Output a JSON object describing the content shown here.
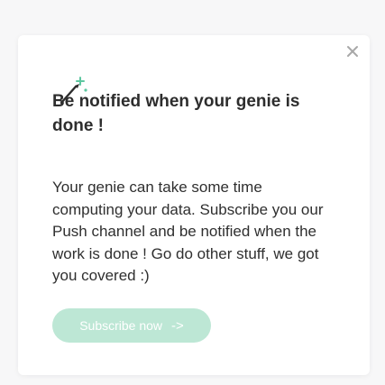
{
  "dialog": {
    "title": "Be notified when your genie is done !",
    "body": "Your genie can take some time computing your data. Subscribe you our Push channel and be notified when the work is done ! Go do other stuff, we got you covered :)",
    "cta_label": "Subscribe now",
    "cta_arrow": "->",
    "icons": {
      "close": "close-icon",
      "header": "magic-wand-icon"
    }
  },
  "colors": {
    "accent_light": "#bde7d5",
    "accent": "#5ec7a0",
    "text": "#2d2d2d",
    "close_icon": "#a8a8a8"
  }
}
